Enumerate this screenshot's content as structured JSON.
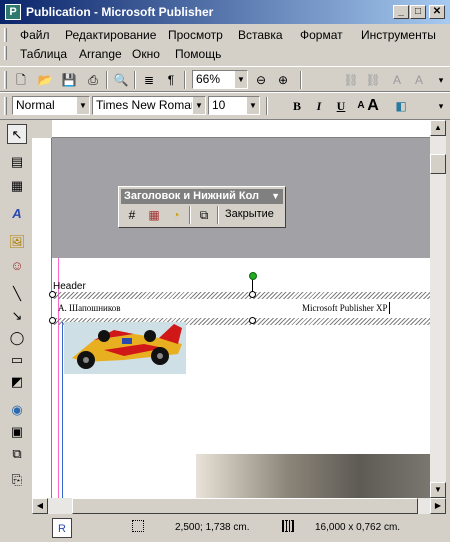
{
  "window": {
    "title": "Publication - Microsoft Publisher",
    "app_icon": "publisher-icon",
    "minimize": "_",
    "maximize": "□",
    "close": "✕"
  },
  "menu": {
    "row1": [
      "Файл",
      "Редактирование",
      "Просмотр",
      "Вставка",
      "Формат",
      "Инструменты"
    ],
    "row2": [
      "Таблица",
      "Arrange",
      "Окно",
      "Помощь"
    ]
  },
  "standard_toolbar": {
    "zoom": "66%"
  },
  "formatting_toolbar": {
    "style": "Normal",
    "font": "Times New Roman",
    "size": "10",
    "bold": "B",
    "italic": "I",
    "underline": "U"
  },
  "floating_toolbar": {
    "title": "Заголовок и Нижний Кол",
    "close_label": "Закрытие"
  },
  "page": {
    "header_label": "Header",
    "header_left": "А. Шапошников",
    "header_right": "Microsoft Publisher XP"
  },
  "status": {
    "page_label": "R",
    "position": "2,500; 1,738 cm.",
    "size": "16,000 x 0,762 cm."
  },
  "colors": {
    "titlebar_start": "#0a246a",
    "titlebar_end": "#a6caf0",
    "workspace": "#a2a2a6",
    "rotate_handle": "#22aa22"
  }
}
